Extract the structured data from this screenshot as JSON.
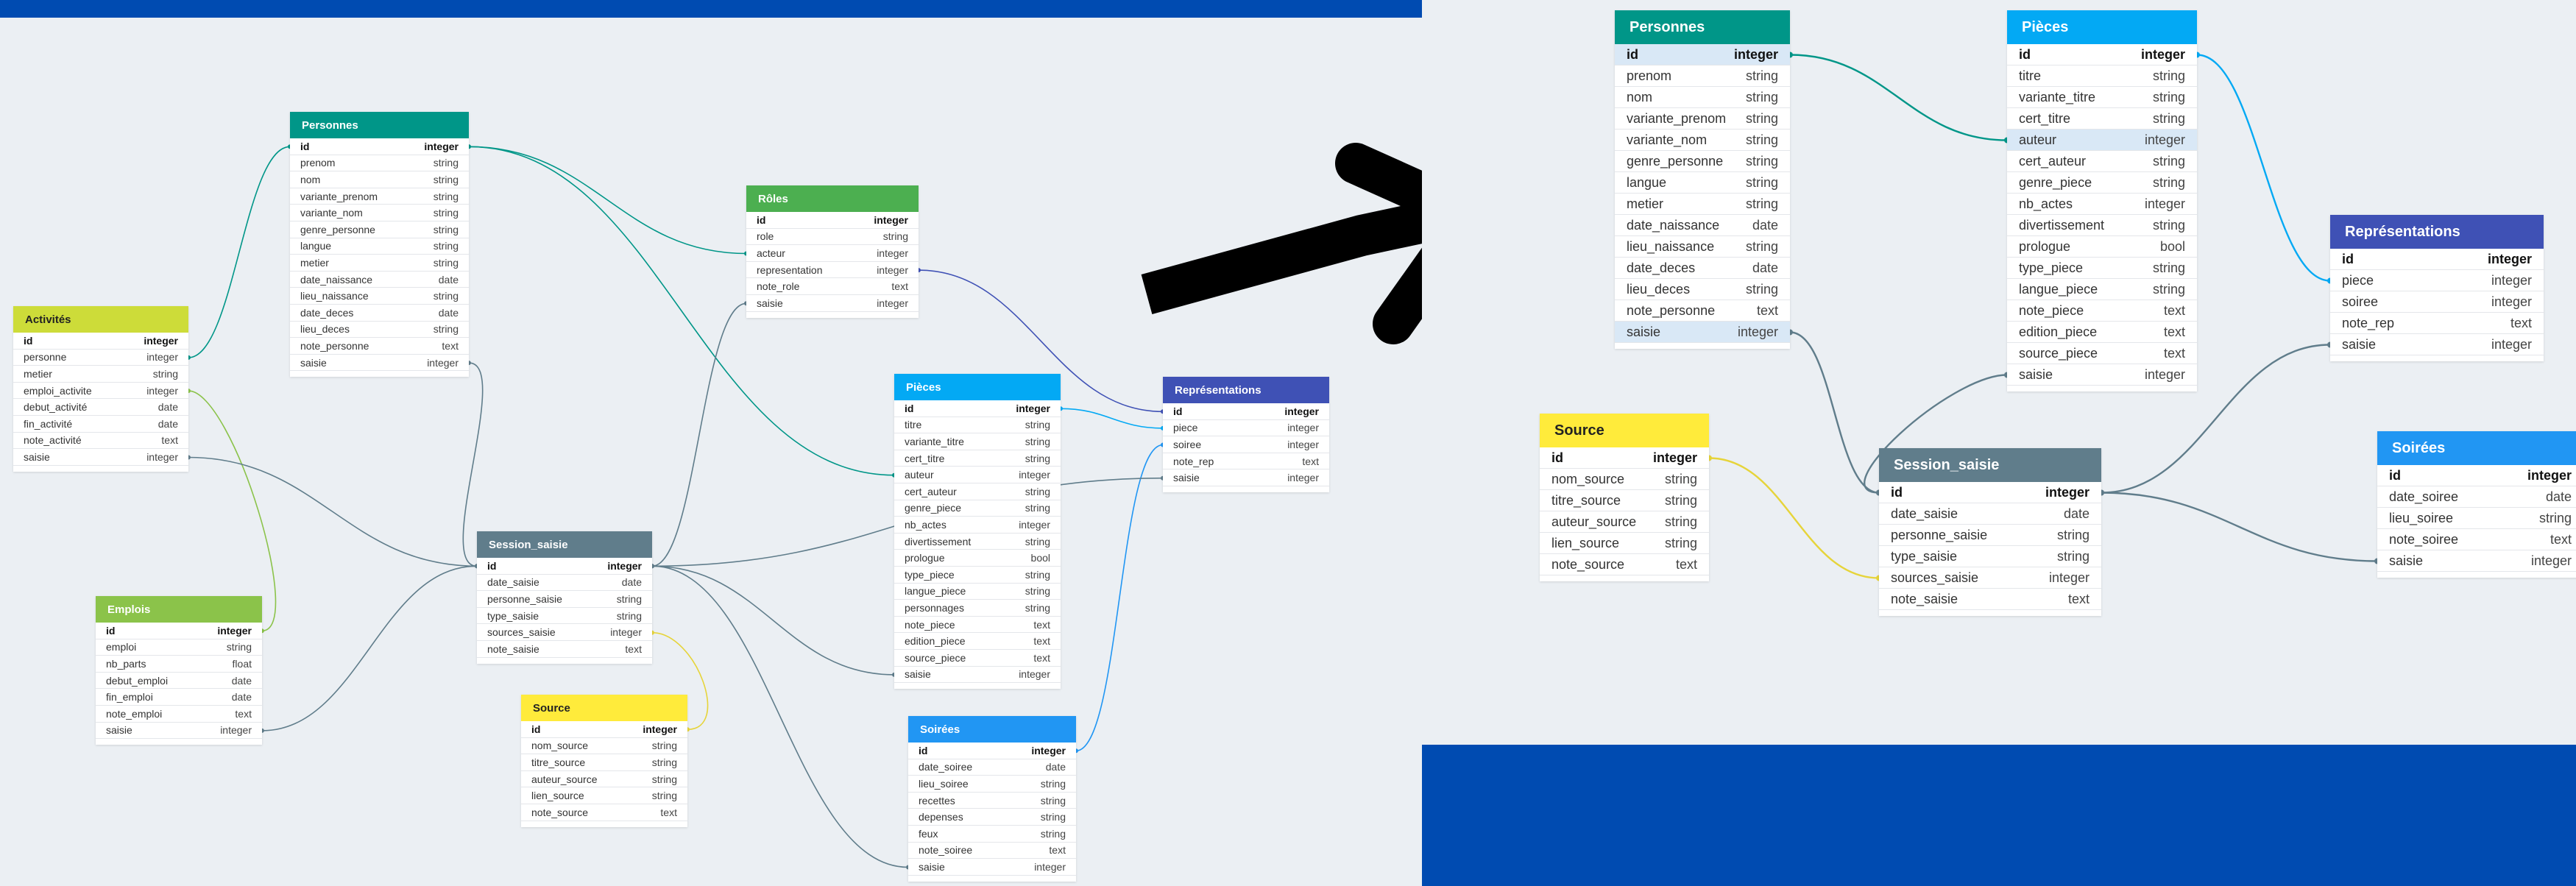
{
  "colors": {
    "band": "#004bb1",
    "canvas": "#ebeff3",
    "arrow": "#000000",
    "Personnes": "#009688",
    "Rôles": "#4caf50",
    "Activités": "#cddc39",
    "Emplois": "#8bc34a",
    "Session_saisie": "#607d8b",
    "Source": "#ffeb3b",
    "Pièces": "#03a9f4",
    "Représentations": "#3f51b5",
    "Soirées": "#2196f3"
  },
  "arrow_icon": "arrow-up-right-icon",
  "left_diagram": {
    "tables": [
      {
        "name": "Personnes",
        "color": "#009688",
        "fields": [
          [
            "id",
            "integer"
          ],
          [
            "prenom",
            "string"
          ],
          [
            "nom",
            "string"
          ],
          [
            "variante_prenom",
            "string"
          ],
          [
            "variante_nom",
            "string"
          ],
          [
            "genre_personne",
            "string"
          ],
          [
            "langue",
            "string"
          ],
          [
            "metier",
            "string"
          ],
          [
            "date_naissance",
            "date"
          ],
          [
            "lieu_naissance",
            "string"
          ],
          [
            "date_deces",
            "date"
          ],
          [
            "lieu_deces",
            "string"
          ],
          [
            "note_personne",
            "text"
          ],
          [
            "saisie",
            "integer"
          ]
        ]
      },
      {
        "name": "Rôles",
        "color": "#4caf50",
        "fields": [
          [
            "id",
            "integer"
          ],
          [
            "role",
            "string"
          ],
          [
            "acteur",
            "integer"
          ],
          [
            "representation",
            "integer"
          ],
          [
            "note_role",
            "text"
          ],
          [
            "saisie",
            "integer"
          ]
        ]
      },
      {
        "name": "Activités",
        "color": "#cddc39",
        "fields": [
          [
            "id",
            "integer"
          ],
          [
            "personne",
            "integer"
          ],
          [
            "metier",
            "string"
          ],
          [
            "emploi_activite",
            "integer"
          ],
          [
            "debut_activité",
            "date"
          ],
          [
            "fin_activité",
            "date"
          ],
          [
            "note_activité",
            "text"
          ],
          [
            "saisie",
            "integer"
          ]
        ]
      },
      {
        "name": "Emplois",
        "color": "#8bc34a",
        "fields": [
          [
            "id",
            "integer"
          ],
          [
            "emploi",
            "string"
          ],
          [
            "nb_parts",
            "float"
          ],
          [
            "debut_emploi",
            "date"
          ],
          [
            "fin_emploi",
            "date"
          ],
          [
            "note_emploi",
            "text"
          ],
          [
            "saisie",
            "integer"
          ]
        ]
      },
      {
        "name": "Session_saisie",
        "color": "#607d8b",
        "fields": [
          [
            "id",
            "integer"
          ],
          [
            "date_saisie",
            "date"
          ],
          [
            "personne_saisie",
            "string"
          ],
          [
            "type_saisie",
            "string"
          ],
          [
            "sources_saisie",
            "integer"
          ],
          [
            "note_saisie",
            "text"
          ]
        ]
      },
      {
        "name": "Source",
        "color": "#ffeb3b",
        "fields": [
          [
            "id",
            "integer"
          ],
          [
            "nom_source",
            "string"
          ],
          [
            "titre_source",
            "string"
          ],
          [
            "auteur_source",
            "string"
          ],
          [
            "lien_source",
            "string"
          ],
          [
            "note_source",
            "text"
          ]
        ]
      },
      {
        "name": "Pièces",
        "color": "#03a9f4",
        "fields": [
          [
            "id",
            "integer"
          ],
          [
            "titre",
            "string"
          ],
          [
            "variante_titre",
            "string"
          ],
          [
            "cert_titre",
            "string"
          ],
          [
            "auteur",
            "integer"
          ],
          [
            "cert_auteur",
            "string"
          ],
          [
            "genre_piece",
            "string"
          ],
          [
            "nb_actes",
            "integer"
          ],
          [
            "divertissement",
            "string"
          ],
          [
            "prologue",
            "bool"
          ],
          [
            "type_piece",
            "string"
          ],
          [
            "langue_piece",
            "string"
          ],
          [
            "personnages",
            "string"
          ],
          [
            "note_piece",
            "text"
          ],
          [
            "edition_piece",
            "text"
          ],
          [
            "source_piece",
            "text"
          ],
          [
            "saisie",
            "integer"
          ]
        ]
      },
      {
        "name": "Représentations",
        "color": "#3f51b5",
        "fields": [
          [
            "id",
            "integer"
          ],
          [
            "piece",
            "integer"
          ],
          [
            "soiree",
            "integer"
          ],
          [
            "note_rep",
            "text"
          ],
          [
            "saisie",
            "integer"
          ]
        ]
      },
      {
        "name": "Soirées",
        "color": "#2196f3",
        "fields": [
          [
            "id",
            "integer"
          ],
          [
            "date_soiree",
            "date"
          ],
          [
            "lieu_soiree",
            "string"
          ],
          [
            "recettes",
            "string"
          ],
          [
            "depenses",
            "string"
          ],
          [
            "feux",
            "string"
          ],
          [
            "note_soiree",
            "text"
          ],
          [
            "saisie",
            "integer"
          ]
        ]
      }
    ]
  },
  "right_diagram": {
    "tables": [
      {
        "name": "Personnes",
        "color": "#009688",
        "fields": [
          [
            "id",
            "integer"
          ],
          [
            "prenom",
            "string"
          ],
          [
            "nom",
            "string"
          ],
          [
            "variante_prenom",
            "string"
          ],
          [
            "variante_nom",
            "string"
          ],
          [
            "genre_personne",
            "string"
          ],
          [
            "langue",
            "string"
          ],
          [
            "metier",
            "string"
          ],
          [
            "date_naissance",
            "date"
          ],
          [
            "lieu_naissance",
            "string"
          ],
          [
            "date_deces",
            "date"
          ],
          [
            "lieu_deces",
            "string"
          ],
          [
            "note_personne",
            "text"
          ],
          [
            "saisie",
            "integer"
          ]
        ]
      },
      {
        "name": "Pièces",
        "color": "#03a9f4",
        "fields": [
          [
            "id",
            "integer"
          ],
          [
            "titre",
            "string"
          ],
          [
            "variante_titre",
            "string"
          ],
          [
            "cert_titre",
            "string"
          ],
          [
            "auteur",
            "integer"
          ],
          [
            "cert_auteur",
            "string"
          ],
          [
            "genre_piece",
            "string"
          ],
          [
            "nb_actes",
            "integer"
          ],
          [
            "divertissement",
            "string"
          ],
          [
            "prologue",
            "bool"
          ],
          [
            "type_piece",
            "string"
          ],
          [
            "langue_piece",
            "string"
          ],
          [
            "note_piece",
            "text"
          ],
          [
            "edition_piece",
            "text"
          ],
          [
            "source_piece",
            "text"
          ],
          [
            "saisie",
            "integer"
          ]
        ]
      },
      {
        "name": "Représentations",
        "color": "#3f51b5",
        "fields": [
          [
            "id",
            "integer"
          ],
          [
            "piece",
            "integer"
          ],
          [
            "soiree",
            "integer"
          ],
          [
            "note_rep",
            "text"
          ],
          [
            "saisie",
            "integer"
          ]
        ]
      },
      {
        "name": "Source",
        "color": "#ffeb3b",
        "fields": [
          [
            "id",
            "integer"
          ],
          [
            "nom_source",
            "string"
          ],
          [
            "titre_source",
            "string"
          ],
          [
            "auteur_source",
            "string"
          ],
          [
            "lien_source",
            "string"
          ],
          [
            "note_source",
            "text"
          ]
        ]
      },
      {
        "name": "Session_saisie",
        "color": "#607d8b",
        "fields": [
          [
            "id",
            "integer"
          ],
          [
            "date_saisie",
            "date"
          ],
          [
            "personne_saisie",
            "string"
          ],
          [
            "type_saisie",
            "string"
          ],
          [
            "sources_saisie",
            "integer"
          ],
          [
            "note_saisie",
            "text"
          ]
        ]
      },
      {
        "name": "Soirées",
        "color": "#2196f3",
        "fields": [
          [
            "id",
            "integer"
          ],
          [
            "date_soiree",
            "date"
          ],
          [
            "lieu_soiree",
            "string"
          ],
          [
            "note_soiree",
            "text"
          ],
          [
            "saisie",
            "integer"
          ]
        ]
      }
    ]
  }
}
